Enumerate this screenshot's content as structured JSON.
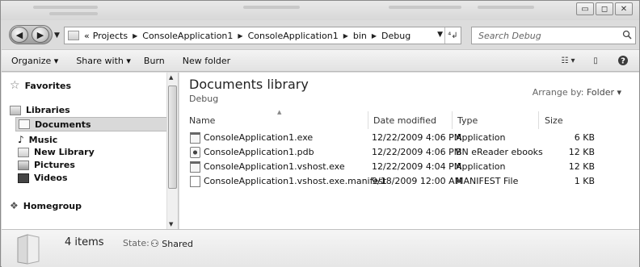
{
  "window": {
    "controls": {
      "minimize": "▭",
      "maximize": "◻",
      "close": "✕"
    }
  },
  "address": {
    "overflow": "«",
    "crumbs": [
      "Projects",
      "ConsoleApplication1",
      "ConsoleApplication1",
      "bin",
      "Debug"
    ]
  },
  "search": {
    "placeholder": "Search Debug"
  },
  "toolbar": {
    "organize": "Organize ▾",
    "share_with": "Share with ▾",
    "burn": "Burn",
    "new_folder": "New folder"
  },
  "sidebar": {
    "favorites": "Favorites",
    "libraries": "Libraries",
    "items": [
      "Documents",
      "Music",
      "New Library",
      "Pictures",
      "Videos"
    ],
    "homegroup": "Homegroup"
  },
  "library": {
    "title": "Documents library",
    "subtitle": "Debug",
    "arrange_label": "Arrange by:",
    "arrange_value": "Folder ▾"
  },
  "columns": {
    "name": "Name",
    "date": "Date modified",
    "type": "Type",
    "size": "Size"
  },
  "files": [
    {
      "name": "ConsoleApplication1.exe",
      "date": "12/22/2009 4:06 PM",
      "type": "Application",
      "size": "6 KB",
      "icon": "exe-icon"
    },
    {
      "name": "ConsoleApplication1.pdb",
      "date": "12/22/2009 4:06 PM",
      "type": "BN eReader ebooks",
      "size": "12 KB",
      "icon": "pdb-icon"
    },
    {
      "name": "ConsoleApplication1.vshost.exe",
      "date": "12/22/2009 4:04 PM",
      "type": "Application",
      "size": "12 KB",
      "icon": "exe-icon"
    },
    {
      "name": "ConsoleApplication1.vshost.exe.manifest",
      "date": "9/18/2009 12:00 AM",
      "type": "MANIFEST File",
      "size": "1 KB",
      "icon": "manifest-icon"
    }
  ],
  "details": {
    "count": "4 items",
    "state_label": "State:",
    "state_value": "Shared"
  }
}
